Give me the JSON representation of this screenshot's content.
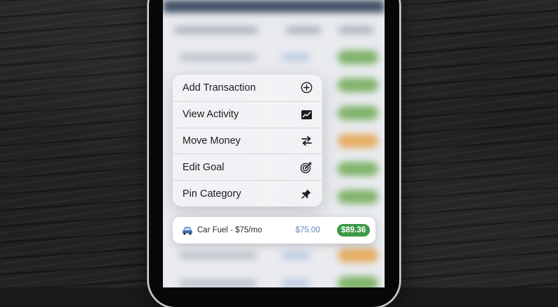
{
  "menu": {
    "items": [
      {
        "label": "Add Transaction",
        "icon": "plus-circle-icon"
      },
      {
        "label": "View Activity",
        "icon": "activity-chart-icon"
      },
      {
        "label": "Move Money",
        "icon": "transfer-arrows-icon"
      },
      {
        "label": "Edit Goal",
        "icon": "target-icon"
      },
      {
        "label": "Pin Category",
        "icon": "pin-icon"
      }
    ]
  },
  "category_row": {
    "icon": "car-icon",
    "name": "Car Fuel - $75/mo",
    "budgeted": "$75.00",
    "available": "$89.36"
  },
  "colors": {
    "available_pill": "#3d9a47",
    "budgeted_text": "#5f84bd",
    "menu_background": "#f1f2f5"
  }
}
